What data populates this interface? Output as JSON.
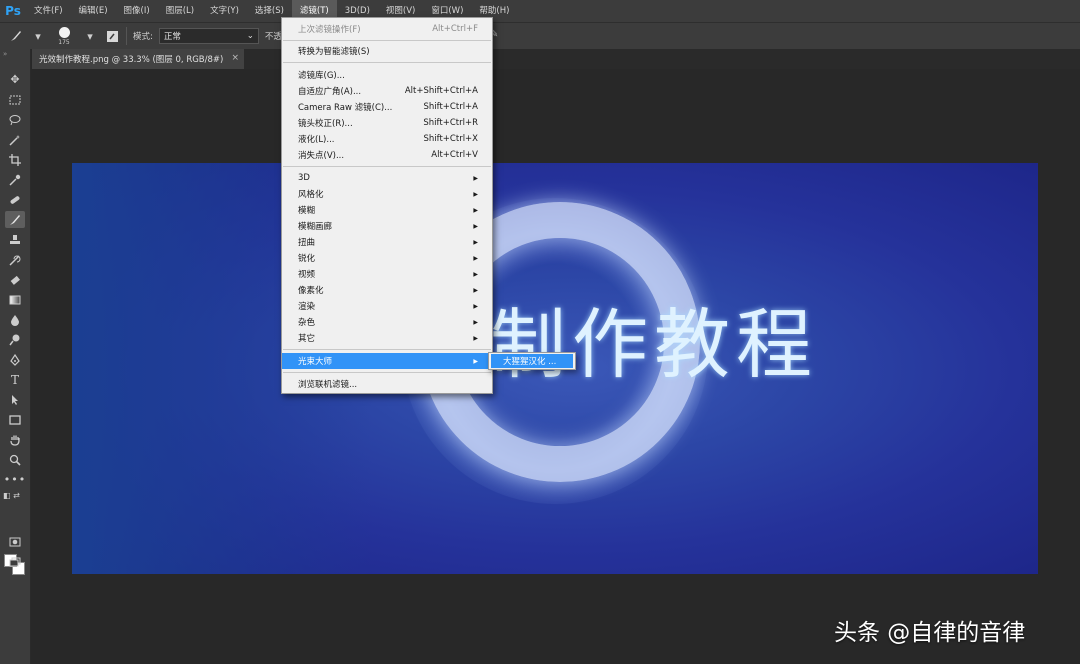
{
  "app": {
    "logo": "Ps"
  },
  "menubar": {
    "items": [
      "文件(F)",
      "编辑(E)",
      "图像(I)",
      "图层(L)",
      "文字(Y)",
      "选择(S)",
      "滤镜(T)",
      "3D(D)",
      "视图(V)",
      "窗口(W)",
      "帮助(H)"
    ]
  },
  "options": {
    "brush_size": "175",
    "mode_label": "模式:",
    "mode_value": "正常",
    "opacity_label": "不透"
  },
  "document": {
    "tab_title": "光效制作教程.png @ 33.3% (图层 0, RGB/8#)",
    "close": "×"
  },
  "canvas": {
    "title_text": "制作教程"
  },
  "filter_menu": {
    "last_filter": {
      "label": "上次滤镜操作(F)",
      "shortcut": "Alt+Ctrl+F"
    },
    "smart": "转换为智能滤镜(S)",
    "group1": [
      {
        "label": "滤镜库(G)...",
        "shortcut": ""
      },
      {
        "label": "自适应广角(A)...",
        "shortcut": "Alt+Shift+Ctrl+A"
      },
      {
        "label": "Camera Raw 滤镜(C)...",
        "shortcut": "Shift+Ctrl+A"
      },
      {
        "label": "镜头校正(R)...",
        "shortcut": "Shift+Ctrl+R"
      },
      {
        "label": "液化(L)...",
        "shortcut": "Shift+Ctrl+X"
      },
      {
        "label": "消失点(V)...",
        "shortcut": "Alt+Ctrl+V"
      }
    ],
    "group2": [
      "3D",
      "风格化",
      "模糊",
      "模糊画廊",
      "扭曲",
      "锐化",
      "视频",
      "像素化",
      "渲染",
      "杂色",
      "其它"
    ],
    "plugin": "光束大师",
    "browse": "浏览联机滤镜...",
    "submenu_item": "大猩猩汉化 ..."
  },
  "watermark": "头条 @自律的音律"
}
